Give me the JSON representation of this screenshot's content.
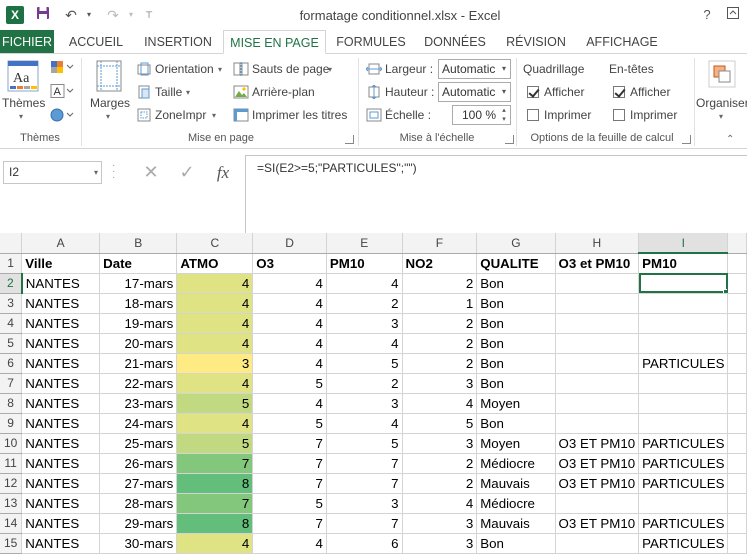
{
  "window": {
    "title": "formatage conditionnel.xlsx - Excel",
    "app_icon": "excel-icon",
    "help_label": "?",
    "colors": {
      "brand": "#217346",
      "active_cell": "#217346"
    }
  },
  "tabs": [
    {
      "label": "FICHIER"
    },
    {
      "label": "ACCUEIL"
    },
    {
      "label": "INSERTION"
    },
    {
      "label": "MISE EN PAGE"
    },
    {
      "label": "FORMULES"
    },
    {
      "label": "DONNÉES"
    },
    {
      "label": "RÉVISION"
    },
    {
      "label": "AFFICHAGE"
    }
  ],
  "ribbon": {
    "themes": {
      "button": "Thèmes",
      "group": "Thèmes"
    },
    "page_setup": {
      "marges": "Marges",
      "orientation": "Orientation",
      "taille": "Taille",
      "zone": "ZoneImpr",
      "sauts": "Sauts de page",
      "arriere_plan": "Arrière-plan",
      "imprimer_titres": "Imprimer les titres",
      "group": "Mise en page"
    },
    "scale": {
      "largeur_label": "Largeur :",
      "largeur_value": "Automatic",
      "hauteur_label": "Hauteur :",
      "hauteur_value": "Automatic",
      "echelle_label": "Échelle :",
      "echelle_value": "100 %",
      "group": "Mise à l'échelle"
    },
    "sheet_options": {
      "quadrillage": "Quadrillage",
      "entetes": "En-têtes",
      "afficher1": "Afficher",
      "imprimer1": "Imprimer",
      "afficher2": "Afficher",
      "imprimer2": "Imprimer",
      "afficher1_checked": true,
      "imprimer1_checked": false,
      "afficher2_checked": true,
      "imprimer2_checked": false,
      "group": "Options de la feuille de calcul"
    },
    "organiser": "Organiser"
  },
  "formula_bar": {
    "name_box": "I2",
    "fx_label": "fx",
    "formula": "=SI(E2>=5;\"PARTICULES\";\"\")"
  },
  "sheet": {
    "columns": [
      "A",
      "B",
      "C",
      "D",
      "E",
      "F",
      "G",
      "H",
      "I"
    ],
    "selected_column": "I",
    "selected_row": "2",
    "header_row": [
      "Ville",
      "Date",
      "ATMO",
      "O3",
      "PM10",
      "NO2",
      "QUALITE",
      "O3 et PM10",
      "PM10"
    ],
    "rows": [
      {
        "n": "2",
        "ville": "NANTES",
        "date": "17-mars",
        "atmo": "4",
        "o3": "4",
        "pm10": "4",
        "no2": "2",
        "qualite": "Bon",
        "o3pm10": "",
        "pm10flag": "",
        "atmo_color": "#e0e383"
      },
      {
        "n": "3",
        "ville": "NANTES",
        "date": "18-mars",
        "atmo": "4",
        "o3": "4",
        "pm10": "2",
        "no2": "1",
        "qualite": "Bon",
        "o3pm10": "",
        "pm10flag": "",
        "atmo_color": "#e0e383"
      },
      {
        "n": "4",
        "ville": "NANTES",
        "date": "19-mars",
        "atmo": "4",
        "o3": "4",
        "pm10": "3",
        "no2": "2",
        "qualite": "Bon",
        "o3pm10": "",
        "pm10flag": "",
        "atmo_color": "#e0e383"
      },
      {
        "n": "5",
        "ville": "NANTES",
        "date": "20-mars",
        "atmo": "4",
        "o3": "4",
        "pm10": "4",
        "no2": "2",
        "qualite": "Bon",
        "o3pm10": "",
        "pm10flag": "",
        "atmo_color": "#e0e383"
      },
      {
        "n": "6",
        "ville": "NANTES",
        "date": "21-mars",
        "atmo": "3",
        "o3": "4",
        "pm10": "5",
        "no2": "2",
        "qualite": "Bon",
        "o3pm10": "",
        "pm10flag": "PARTICULES",
        "atmo_color": "#ffeb84"
      },
      {
        "n": "7",
        "ville": "NANTES",
        "date": "22-mars",
        "atmo": "4",
        "o3": "5",
        "pm10": "2",
        "no2": "3",
        "qualite": "Bon",
        "o3pm10": "",
        "pm10flag": "",
        "atmo_color": "#e0e383"
      },
      {
        "n": "8",
        "ville": "NANTES",
        "date": "23-mars",
        "atmo": "5",
        "o3": "4",
        "pm10": "3",
        "no2": "4",
        "qualite": "Moyen",
        "o3pm10": "",
        "pm10flag": "",
        "atmo_color": "#c1da81"
      },
      {
        "n": "9",
        "ville": "NANTES",
        "date": "24-mars",
        "atmo": "4",
        "o3": "5",
        "pm10": "4",
        "no2": "5",
        "qualite": "Bon",
        "o3pm10": "",
        "pm10flag": "",
        "atmo_color": "#e0e383"
      },
      {
        "n": "10",
        "ville": "NANTES",
        "date": "25-mars",
        "atmo": "5",
        "o3": "7",
        "pm10": "5",
        "no2": "3",
        "qualite": "Moyen",
        "o3pm10": "O3 ET PM10",
        "pm10flag": "PARTICULES",
        "atmo_color": "#c1da81"
      },
      {
        "n": "11",
        "ville": "NANTES",
        "date": "26-mars",
        "atmo": "7",
        "o3": "7",
        "pm10": "7",
        "no2": "2",
        "qualite": "Médiocre",
        "o3pm10": "O3 ET PM10",
        "pm10flag": "PARTICULES",
        "atmo_color": "#83c77d"
      },
      {
        "n": "12",
        "ville": "NANTES",
        "date": "27-mars",
        "atmo": "8",
        "o3": "7",
        "pm10": "7",
        "no2": "2",
        "qualite": "Mauvais",
        "o3pm10": "O3 ET PM10",
        "pm10flag": "PARTICULES",
        "atmo_color": "#63be7b"
      },
      {
        "n": "13",
        "ville": "NANTES",
        "date": "28-mars",
        "atmo": "7",
        "o3": "5",
        "pm10": "3",
        "no2": "4",
        "qualite": "Médiocre",
        "o3pm10": "",
        "pm10flag": "",
        "atmo_color": "#83c77d"
      },
      {
        "n": "14",
        "ville": "NANTES",
        "date": "29-mars",
        "atmo": "8",
        "o3": "7",
        "pm10": "7",
        "no2": "3",
        "qualite": "Mauvais",
        "o3pm10": "O3 ET PM10",
        "pm10flag": "PARTICULES",
        "atmo_color": "#63be7b"
      },
      {
        "n": "15",
        "ville": "NANTES",
        "date": "30-mars",
        "atmo": "4",
        "o3": "4",
        "pm10": "6",
        "no2": "3",
        "qualite": "Bon",
        "o3pm10": "",
        "pm10flag": "PARTICULES",
        "atmo_color": "#e0e383"
      }
    ]
  }
}
